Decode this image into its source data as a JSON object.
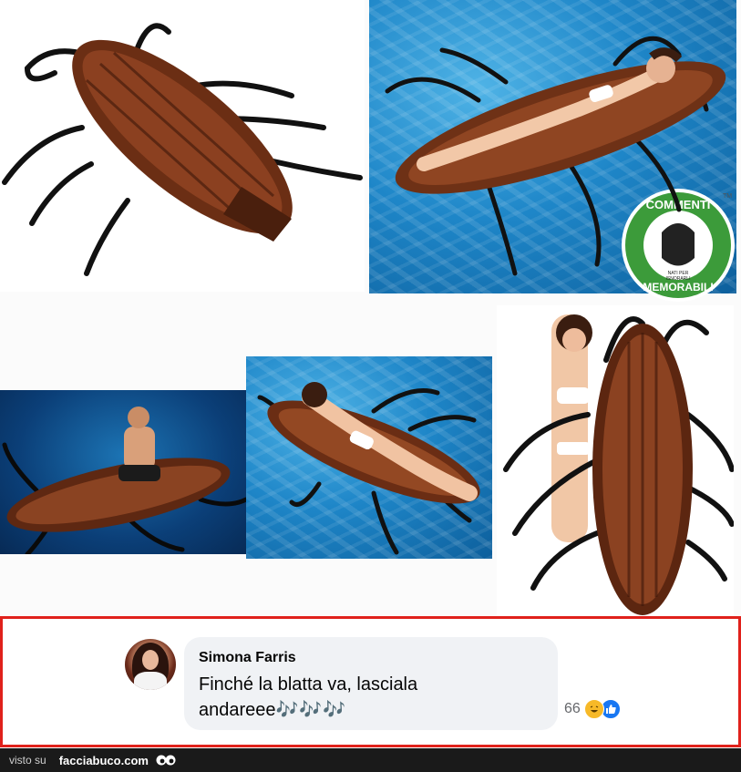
{
  "images": {
    "top_left": "cockroach-float",
    "top_right": "woman-on-cockroach-float-in-pool",
    "bottom_left": "man-riding-cockroach-float",
    "bottom_center": "woman-lying-on-cockroach-float",
    "bottom_right": "woman-holding-upright-cockroach-float"
  },
  "badge": {
    "top_text": "COMMENTI",
    "bottom_text": "MEMORABILI",
    "small_text": "NATI PER",
    "small_text_2": "ISNORARLI",
    "tm": "TM",
    "color": "#3c9b3a"
  },
  "comment": {
    "author": "Simona Farris",
    "text_line1": "Finché la blatta va, lasciala",
    "text_line2": "andareee",
    "notes": "🎶🎶🎶",
    "reaction_count": "66",
    "reactions": [
      "haha-icon",
      "like-icon"
    ]
  },
  "footer": {
    "visto_su": "visto su",
    "site": "facciabuco.com"
  },
  "colors": {
    "frame": "#e0211b",
    "bubble": "#f0f2f5",
    "like_blue": "#1877f2",
    "haha_yellow": "#f7b928"
  }
}
